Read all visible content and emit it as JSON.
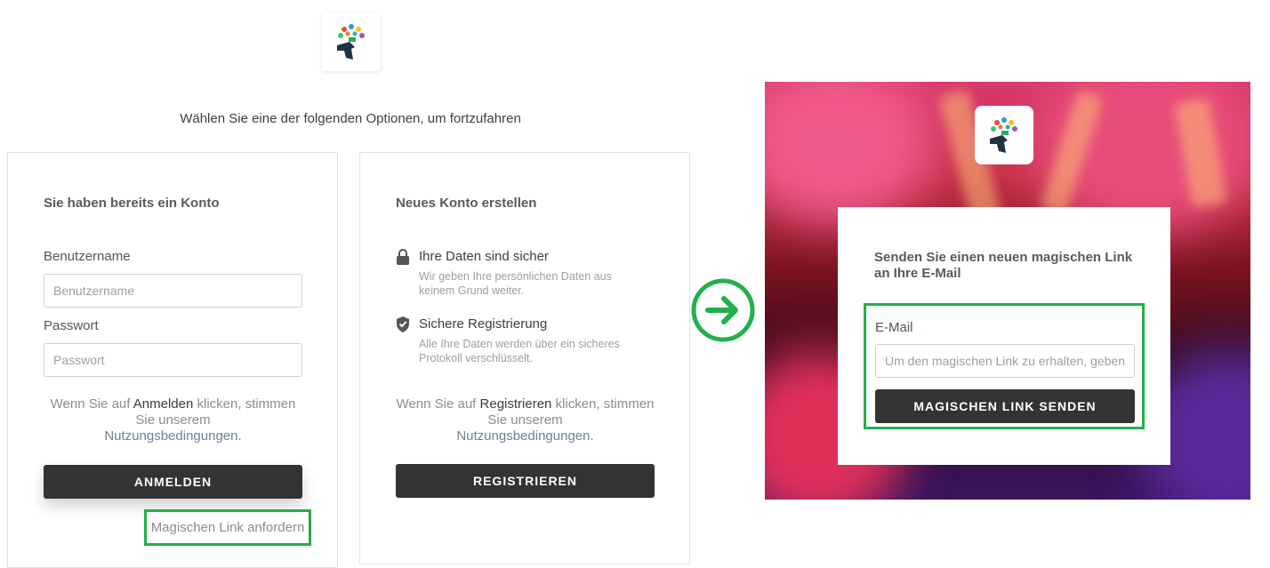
{
  "intro_text": "Wählen Sie eine der folgenden Optionen, um fortzufahren",
  "login": {
    "heading": "Sie haben bereits ein Konto",
    "username_label": "Benutzername",
    "username_placeholder": "Benutzername",
    "password_label": "Passwort",
    "password_placeholder": "Passwort",
    "terms_prefix": "Wenn Sie auf ",
    "terms_action": "Anmelden",
    "terms_middle": " klicken, stimmen Sie unserem",
    "terms_link": "Nutzungsbedingungen.",
    "button": "ANMELDEN",
    "magic_link": "Magischen Link anfordern"
  },
  "register": {
    "heading": "Neues Konto erstellen",
    "features": [
      {
        "title": "Ihre Daten sind sicher",
        "desc": "Wir geben Ihre persönlichen Daten aus keinem Grund weiter.",
        "icon": "lock-icon"
      },
      {
        "title": "Sichere Registrierung",
        "desc": "Alle Ihre Daten werden über ein sicheres Protokoll verschlüsselt.",
        "icon": "shield-check-icon"
      }
    ],
    "terms_prefix": "Wenn Sie auf ",
    "terms_action": "Registrieren",
    "terms_middle": " klicken, stimmen Sie unserem",
    "terms_link": "Nutzungsbedingungen.",
    "button": "REGISTRIEREN"
  },
  "magic_panel": {
    "heading": "Senden Sie einen neuen magischen Link an Ihre E-Mail",
    "email_label": "E-Mail",
    "email_placeholder": "Um den magischen Link zu erhalten, geben Sie Ihre E-Mail ein",
    "button": "MAGISCHEN LINK SENDEN"
  },
  "colors": {
    "highlight": "#22b04b",
    "button": "#333333",
    "link": "#6a8494"
  }
}
